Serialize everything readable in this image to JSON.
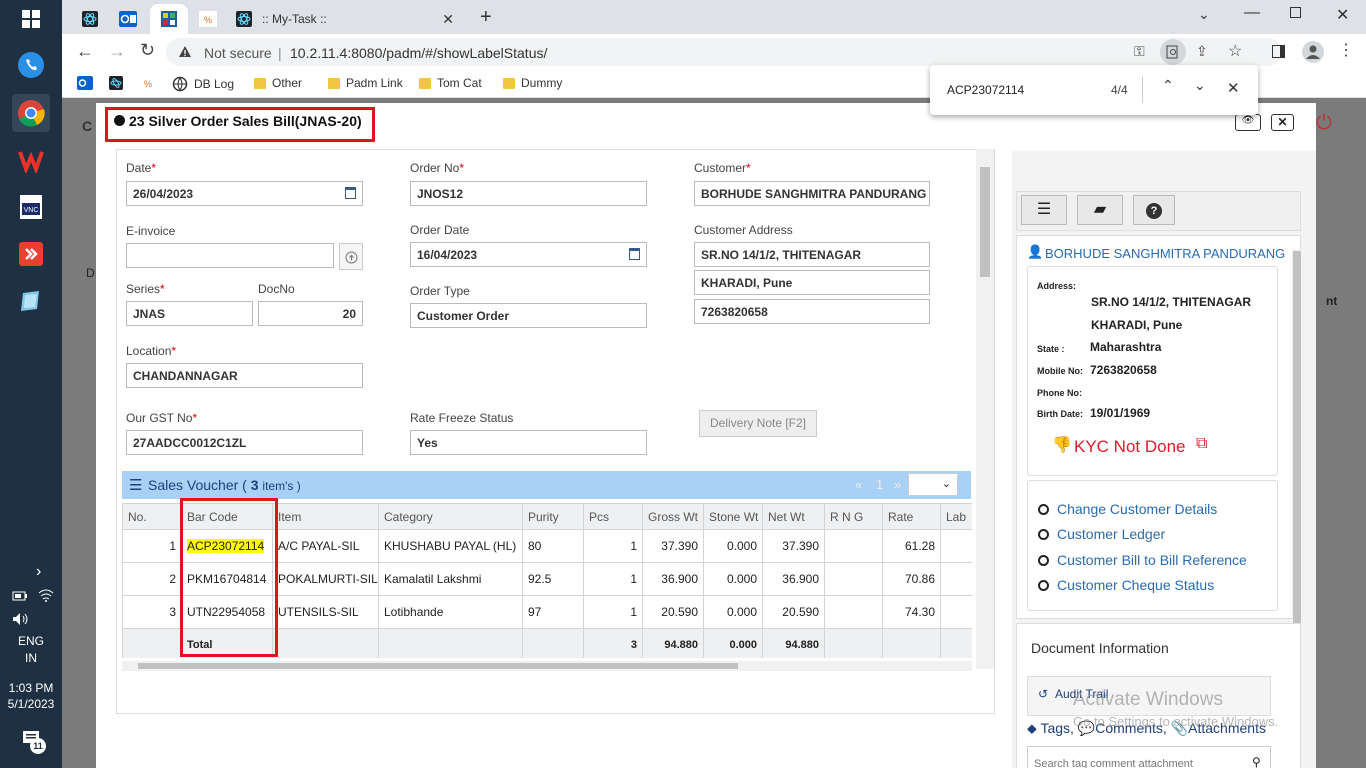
{
  "taskbar": {
    "time": "1:03 PM",
    "date": "5/1/2023",
    "lang": "ENG",
    "region": "IN",
    "badge": "11"
  },
  "browser": {
    "tab_title": ":: My-Task ::",
    "security": "Not secure",
    "url": "10.2.11.4:8080/padm/#/showLabelStatus/",
    "bookmarks": [
      "DB Log",
      "Other",
      "Padm Link",
      "Tom Cat",
      "Dummy"
    ]
  },
  "find": {
    "query": "ACP23072114",
    "count": "4/4"
  },
  "modal": {
    "title": "23 Silver Order Sales Bill(JNAS-20)"
  },
  "form": {
    "date_label": "Date",
    "date": "26/04/2023",
    "order_no_label": "Order No",
    "order_no": "JNOS12",
    "customer_label": "Customer",
    "customer": "BORHUDE SANGHMITRA PANDURANG",
    "einvoice_label": "E-invoice",
    "einvoice": "",
    "order_date_label": "Order Date",
    "order_date": "16/04/2023",
    "cust_addr_label": "Customer Address",
    "addr1": "SR.NO 14/1/2, THITENAGAR",
    "addr2": "KHARADI, Pune",
    "phone": "7263820658",
    "series_label": "Series",
    "series": "JNAS",
    "docno_label": "DocNo",
    "docno": "20",
    "order_type_label": "Order Type",
    "order_type": "Customer Order",
    "location_label": "Location",
    "location": "CHANDANNAGAR",
    "gst_label": "Our GST No",
    "gst": "27AADCC0012C1ZL",
    "rate_freeze_label": "Rate Freeze Status",
    "rate_freeze": "Yes",
    "delivery_btn": "Delivery Note [F2]"
  },
  "voucher": {
    "title": "Sales Voucher (",
    "count": "3",
    "suffix": "item's )",
    "page": "1",
    "prev": "«",
    "next": "»",
    "headers": [
      "No.",
      "Bar Code",
      "Item",
      "Category",
      "Purity",
      "Pcs",
      "Gross Wt",
      "Stone Wt",
      "Net Wt",
      "R N G",
      "Rate",
      "Lab"
    ],
    "rows": [
      [
        "1",
        "ACP23072114",
        "A/C PAYAL-SIL",
        "KHUSHABU PAYAL (HL)",
        "80",
        "1",
        "37.390",
        "0.000",
        "37.390",
        "",
        "61.28"
      ],
      [
        "2",
        "PKM16704814",
        "POKALMURTI-SIL",
        "Kamalatil Lakshmi",
        "92.5",
        "1",
        "36.900",
        "0.000",
        "36.900",
        "",
        "70.86"
      ],
      [
        "3",
        "UTN22954058",
        "UTENSILS-SIL",
        "Lotibhande",
        "97",
        "1",
        "20.590",
        "0.000",
        "20.590",
        "",
        "74.30"
      ]
    ],
    "total": {
      "label": "Total",
      "pcs": "3",
      "gross": "94.880",
      "stone": "0.000",
      "net": "94.880"
    }
  },
  "side": {
    "name": "BORHUDE SANGHMITRA PANDURANG",
    "address_label": "Address:",
    "addr1": "SR.NO 14/1/2, THITENAGAR",
    "addr2": "KHARADI, Pune",
    "state_label": "State :",
    "state": "Maharashtra",
    "mobile_label": "Mobile No:",
    "mobile": "7263820658",
    "phone_label": "Phone No:",
    "phone": "",
    "birth_label": "Birth Date:",
    "birth": "19/01/1969",
    "kyc": "KYC Not Done",
    "links": [
      "Change Customer Details",
      "Customer Ledger",
      "Customer Bill to Bill Reference",
      "Customer Cheque Status"
    ],
    "doc_info": "Document Information",
    "audit": "Audit Trail",
    "tags": "Tags,",
    "comments": "Comments,",
    "attachments": "Attachments",
    "search_ph": "Search tag comment attachment"
  },
  "watermark": {
    "line1": "Activate Windows",
    "line2": "Go to Settings to activate Windows."
  },
  "background": {
    "c_text": "C",
    "d_text": "D",
    "nt_text": "nt"
  }
}
